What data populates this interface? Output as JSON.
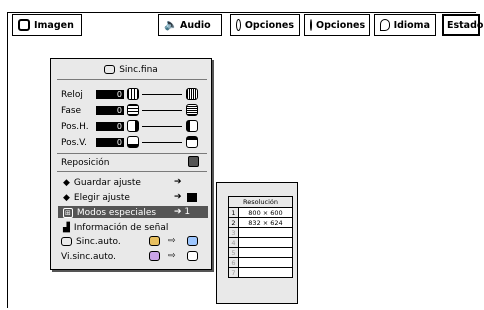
{
  "tabs": [
    {
      "label": "Imagen",
      "icon": "monitor-icon"
    },
    {
      "label": "Audio",
      "icon": "speaker-icon"
    },
    {
      "label": "Opciones",
      "icon": "options-icon"
    },
    {
      "label": "Opciones",
      "icon": "options-icon"
    },
    {
      "label": "Idioma",
      "icon": "speech-bubble-icon"
    },
    {
      "label": "Estado",
      "icon": ""
    }
  ],
  "menu": {
    "title": "Sinc.fina",
    "sliders": [
      {
        "label": "Reloj",
        "value": "0"
      },
      {
        "label": "Fase",
        "value": "0"
      },
      {
        "label": "Pos.H.",
        "value": "0"
      },
      {
        "label": "Pos.V.",
        "value": "0"
      }
    ],
    "reposicion": "Reposición",
    "items": [
      {
        "label": "Guardar ajuste",
        "suffix": "➔"
      },
      {
        "label": "Elegir ajuste",
        "suffix": "➔"
      },
      {
        "label": "Modos especiales",
        "suffix": "➔ 1"
      },
      {
        "label": "Información de señal",
        "suffix": ""
      },
      {
        "label": "Sinc.auto.",
        "suffix": ""
      },
      {
        "label": "Vi.sinc.auto.",
        "suffix": ""
      }
    ]
  },
  "submenu": {
    "header": "Resolución",
    "rows": [
      {
        "n": "1",
        "v": "800 × 600"
      },
      {
        "n": "2",
        "v": "832 × 624"
      },
      {
        "n": "3",
        "v": ""
      },
      {
        "n": "4",
        "v": ""
      },
      {
        "n": "5",
        "v": ""
      },
      {
        "n": "6",
        "v": ""
      },
      {
        "n": "7",
        "v": ""
      }
    ]
  }
}
